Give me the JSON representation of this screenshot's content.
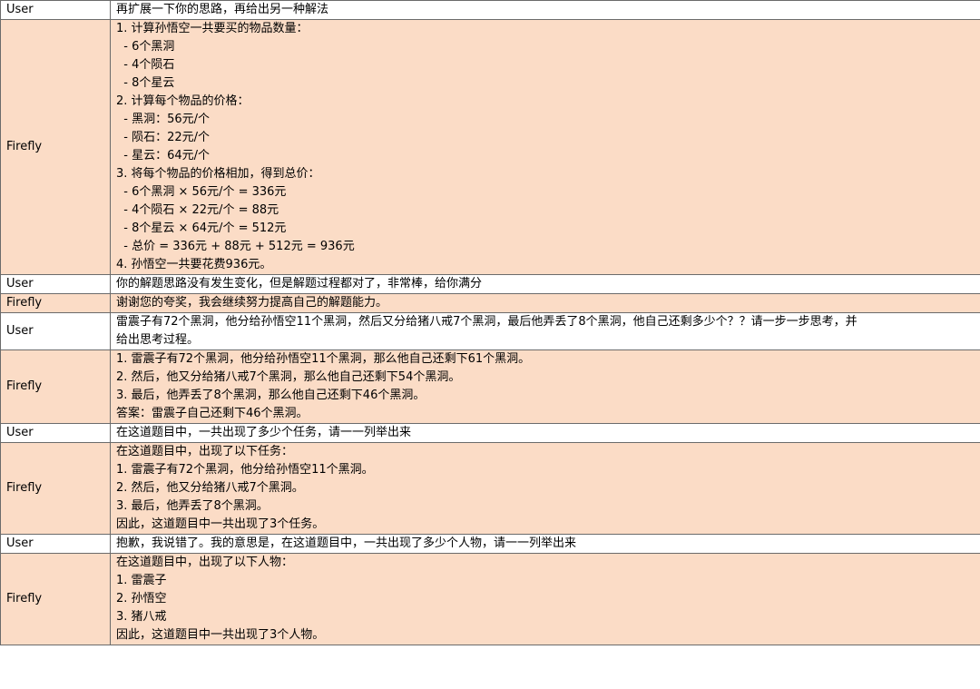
{
  "rows": [
    {
      "role": "User",
      "lines": [
        "再扩展一下你的思路，再给出另一种解法"
      ]
    },
    {
      "role": "Firefly",
      "lines": [
        "1. 计算孙悟空一共要买的物品数量：",
        "  - 6个黑洞",
        "  - 4个陨石",
        "  - 8个星云",
        "2. 计算每个物品的价格：",
        "  - 黑洞：56元/个",
        "  - 陨石：22元/个",
        "  - 星云：64元/个",
        "3. 将每个物品的价格相加，得到总价：",
        "  - 6个黑洞 × 56元/个 = 336元",
        "  - 4个陨石 × 22元/个 = 88元",
        "  - 8个星云 × 64元/个 = 512元",
        "  - 总价 = 336元 + 88元 + 512元 = 936元",
        "4. 孙悟空一共要花费936元。"
      ]
    },
    {
      "role": "User",
      "lines": [
        "你的解题思路没有发生变化，但是解题过程都对了，非常棒，给你满分"
      ]
    },
    {
      "role": "Firefly",
      "lines": [
        "谢谢您的夸奖，我会继续努力提高自己的解题能力。"
      ]
    },
    {
      "role": "User",
      "lines": [
        "雷震子有72个黑洞，他分给孙悟空11个黑洞，然后又分给猪八戒7个黑洞，最后他弄丢了8个黑洞，他自己还剩多少个？？请一步一步思考，并",
        "给出思考过程。"
      ]
    },
    {
      "role": "Firefly",
      "lines": [
        "1. 雷震子有72个黑洞，他分给孙悟空11个黑洞，那么他自己还剩下61个黑洞。",
        "2. 然后，他又分给猪八戒7个黑洞，那么他自己还剩下54个黑洞。",
        "3. 最后，他弄丢了8个黑洞，那么他自己还剩下46个黑洞。",
        "答案：雷震子自己还剩下46个黑洞。"
      ]
    },
    {
      "role": "User",
      "lines": [
        "在这道题目中，一共出现了多少个任务，请一一列举出来"
      ]
    },
    {
      "role": "Firefly",
      "lines": [
        "在这道题目中，出现了以下任务：",
        "1. 雷震子有72个黑洞，他分给孙悟空11个黑洞。",
        "2. 然后，他又分给猪八戒7个黑洞。",
        "3. 最后，他弄丢了8个黑洞。",
        "因此，这道题目中一共出现了3个任务。"
      ]
    },
    {
      "role": "User",
      "lines": [
        "抱歉，我说错了。我的意思是，在这道题目中，一共出现了多少个人物，请一一列举出来"
      ]
    },
    {
      "role": "Firefly",
      "lines": [
        "在这道题目中，出现了以下人物：",
        "1. 雷震子",
        "2. 孙悟空",
        "3. 猪八戒",
        "因此，这道题目中一共出现了3个人物。"
      ]
    }
  ]
}
